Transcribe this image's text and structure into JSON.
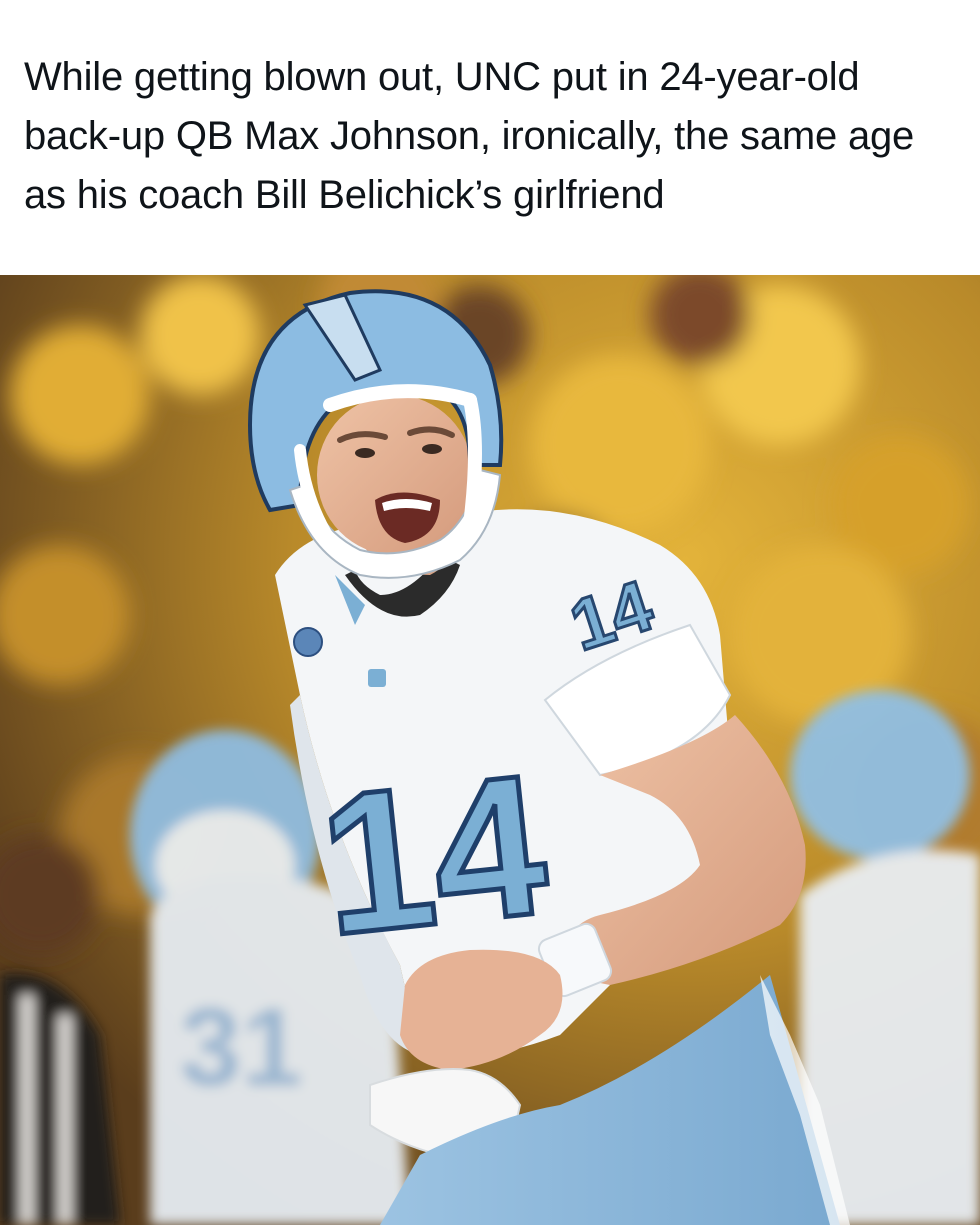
{
  "post": {
    "caption": "While getting blown out, UNC put in 24-year-old back-up QB Max Johnson, ironically, the same age as his coach Bill Belichick’s girlfriend"
  },
  "photo": {
    "subject": "football-player",
    "jersey_number": "14",
    "colors": {
      "carolina_blue": "#7bafd4",
      "jersey_white": "#f4f6f8",
      "crowd_gold": "#d9a52a"
    }
  }
}
